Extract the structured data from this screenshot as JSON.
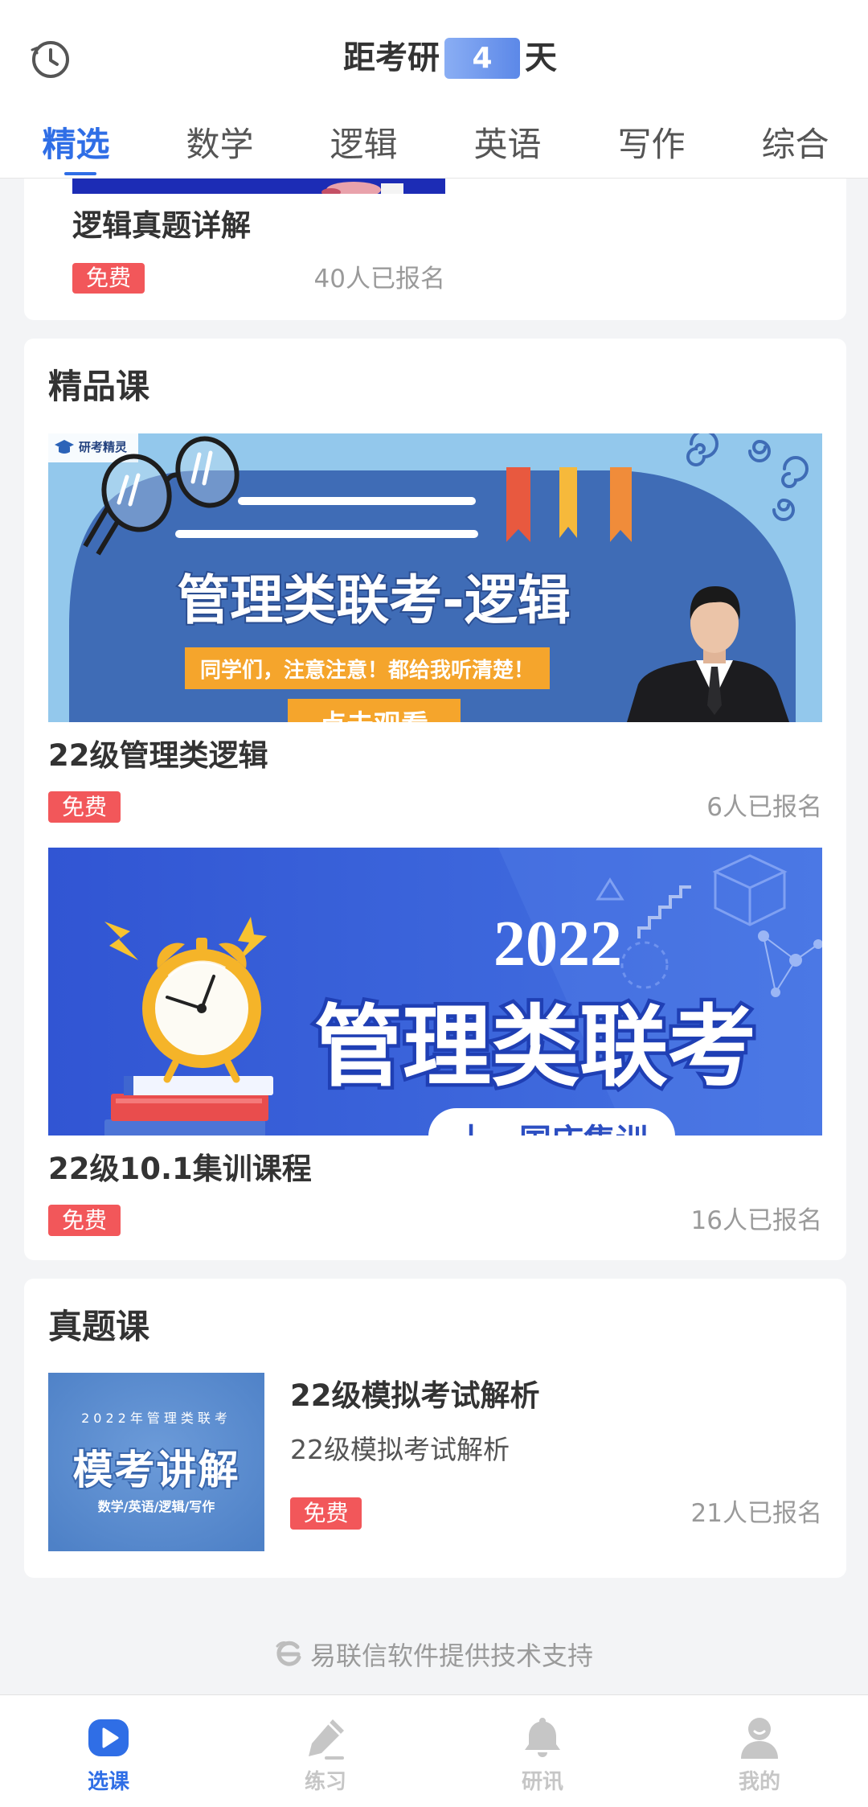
{
  "header": {
    "history_icon": "clock-icon",
    "countdown": {
      "prefix": "距考研",
      "days": "4",
      "suffix": "天"
    }
  },
  "tabs": [
    {
      "label": "精选",
      "active": true
    },
    {
      "label": "数学",
      "active": false
    },
    {
      "label": "逻辑",
      "active": false
    },
    {
      "label": "英语",
      "active": false
    },
    {
      "label": "写作",
      "active": false
    },
    {
      "label": "综合",
      "active": false
    }
  ],
  "partial_card": {
    "title": "逻辑真题详解",
    "badge": "免费",
    "enrolled": "40人已报名"
  },
  "premium_section": {
    "heading": "精品课",
    "courses": [
      {
        "title": "22级管理类逻辑",
        "badge": "免费",
        "enrolled": "6人已报名",
        "banner": {
          "logo_text": "研考精灵",
          "headline": "管理类联考-逻辑",
          "subtitle": "同学们，注意注意！都给我听清楚！",
          "cta": "点击观看"
        }
      },
      {
        "title": "22级10.1集训课程",
        "badge": "免费",
        "enrolled": "16人已报名",
        "banner": {
          "year": "2022",
          "headline": "管理类联考",
          "tag": "十一国庆集训"
        }
      }
    ]
  },
  "past_exam_section": {
    "heading": "真题课",
    "courses": [
      {
        "title": "22级模拟考试解析",
        "subtitle": "22级模拟考试解析",
        "badge": "免费",
        "enrolled": "21人已报名",
        "thumbnail": {
          "top_line": "2022年管理类联考",
          "headline": "模考讲解",
          "bottom_line": "数学/英语/逻辑/写作"
        }
      }
    ]
  },
  "footer": {
    "logo_icon": "yilianxin-logo-icon",
    "text": "易联信软件提供技术支持"
  },
  "bottom_nav": [
    {
      "label": "选课",
      "icon": "play-icon",
      "active": true
    },
    {
      "label": "练习",
      "icon": "pencil-icon",
      "active": false
    },
    {
      "label": "研讯",
      "icon": "bell-icon",
      "active": false
    },
    {
      "label": "我的",
      "icon": "user-icon",
      "active": false
    }
  ],
  "colors": {
    "accent": "#2f6ee6",
    "badge": "#f2575a",
    "text": "#333333",
    "muted": "#9a9a9a",
    "inactive_nav": "#c6c6c6",
    "page_bg": "#f3f4f6"
  }
}
